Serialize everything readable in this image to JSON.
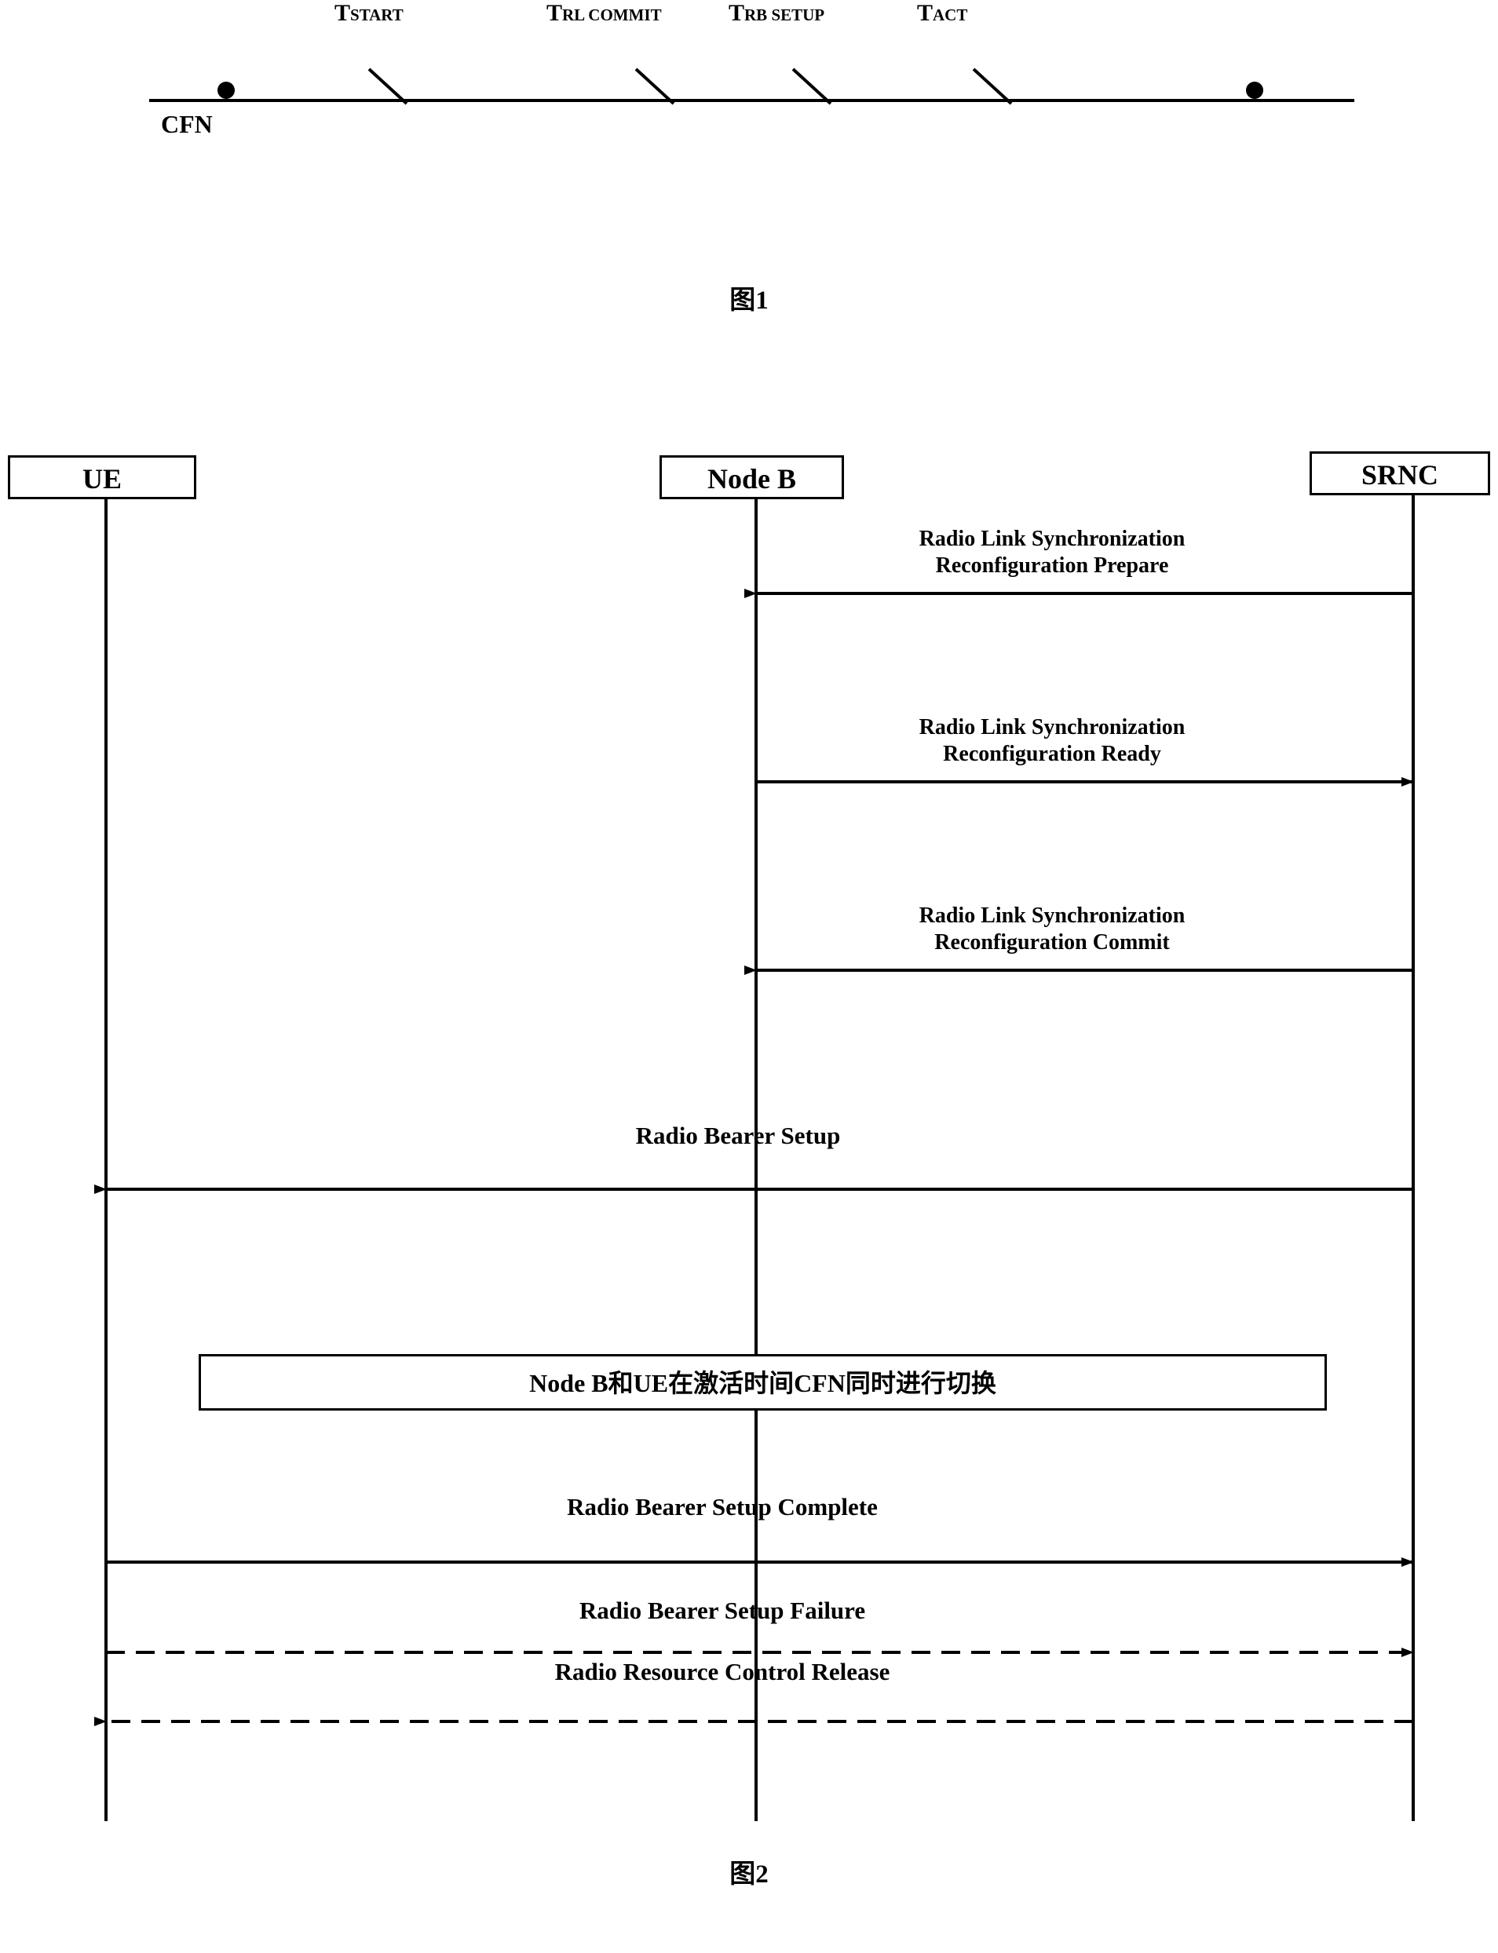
{
  "figure1": {
    "caption": "图1",
    "axis_label": "CFN",
    "ticks": [
      {
        "main": "T",
        "sub": "START"
      },
      {
        "main": "T",
        "sub": "RL COMMIT"
      },
      {
        "main": "T",
        "sub": "RB SETUP"
      },
      {
        "main": "T",
        "sub": "ACT"
      }
    ]
  },
  "figure2": {
    "caption": "图2",
    "lifelines": [
      {
        "name": "UE"
      },
      {
        "name": "Node B"
      },
      {
        "name": "SRNC"
      }
    ],
    "messages": [
      {
        "label": "Radio Link Synchronization\nReconfiguration Prepare",
        "from": "SRNC",
        "to": "Node B",
        "style": "solid"
      },
      {
        "label": "Radio Link Synchronization\nReconfiguration Ready",
        "from": "Node B",
        "to": "SRNC",
        "style": "solid"
      },
      {
        "label": "Radio Link Synchronization\nReconfiguration Commit",
        "from": "SRNC",
        "to": "Node B",
        "style": "solid"
      },
      {
        "label": "Radio Bearer Setup",
        "from": "SRNC",
        "to": "UE",
        "style": "solid"
      },
      {
        "label": "Radio Bearer Setup Complete",
        "from": "UE",
        "to": "SRNC",
        "style": "solid"
      },
      {
        "label": "Radio Bearer Setup Failure",
        "from": "UE",
        "to": "SRNC",
        "style": "dashed"
      },
      {
        "label": "Radio Resource Control Release",
        "from": "SRNC",
        "to": "UE",
        "style": "dashed"
      }
    ],
    "note": "Node B和UE在激活时间CFN同时进行切换"
  },
  "colors": {
    "stroke": "#000000",
    "background": "#ffffff"
  }
}
